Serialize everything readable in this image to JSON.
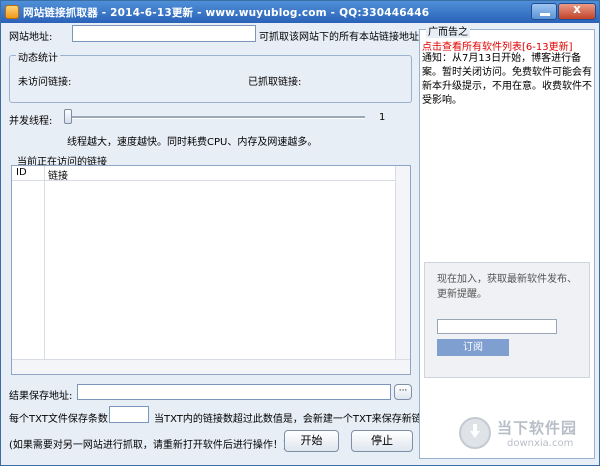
{
  "window": {
    "title": "网站链接抓取器 - 2014-6-13更新 - www.wuyublog.com - QQ:330446446",
    "minimize_glyph": "",
    "close_glyph": "x"
  },
  "url_row": {
    "label": "网站地址:",
    "value": "",
    "hint": "可抓取该网站下的所有本站链接地址。"
  },
  "stats": {
    "title": "动态统计",
    "unvisited_label": "未访问链接:",
    "crawled_label": "已抓取链接:"
  },
  "threads": {
    "label": "并发线程:",
    "value": "1",
    "level": 0,
    "note": "线程越大，速度越快。同时耗费CPU、内存及网速越多。"
  },
  "link_list": {
    "title": "当前正在访问的链接",
    "columns": [
      "ID",
      "链接"
    ]
  },
  "save": {
    "label": "结果保存地址:",
    "value": "",
    "browse_label": "···"
  },
  "per_file": {
    "label": "每个TXT文件保存条数:",
    "value": "",
    "note": "当TXT内的链接数超过此数值是，会新建一个TXT来保存新链接。"
  },
  "footer": {
    "note": "(如果需要对另一网站进行抓取，请重新打开软件后进行操作！)",
    "start_label": "开始",
    "stop_label": "停止"
  },
  "ad": {
    "title": "广而告之",
    "red_link": "点击查看所有软件列表[6-13更新]",
    "notice": "通知：从7月13日开始，博客进行备案。暂时关闭访问。免费软件可能会有新本升级提示，不用在意。收费软件不受影响。",
    "subscribe_text": "现在加入，获取最新软件发布、更新提醒。",
    "subscribe_value": "",
    "subscribe_button": "订阅"
  },
  "watermark": {
    "cn": "当下软件园",
    "en": "downxia.com"
  }
}
